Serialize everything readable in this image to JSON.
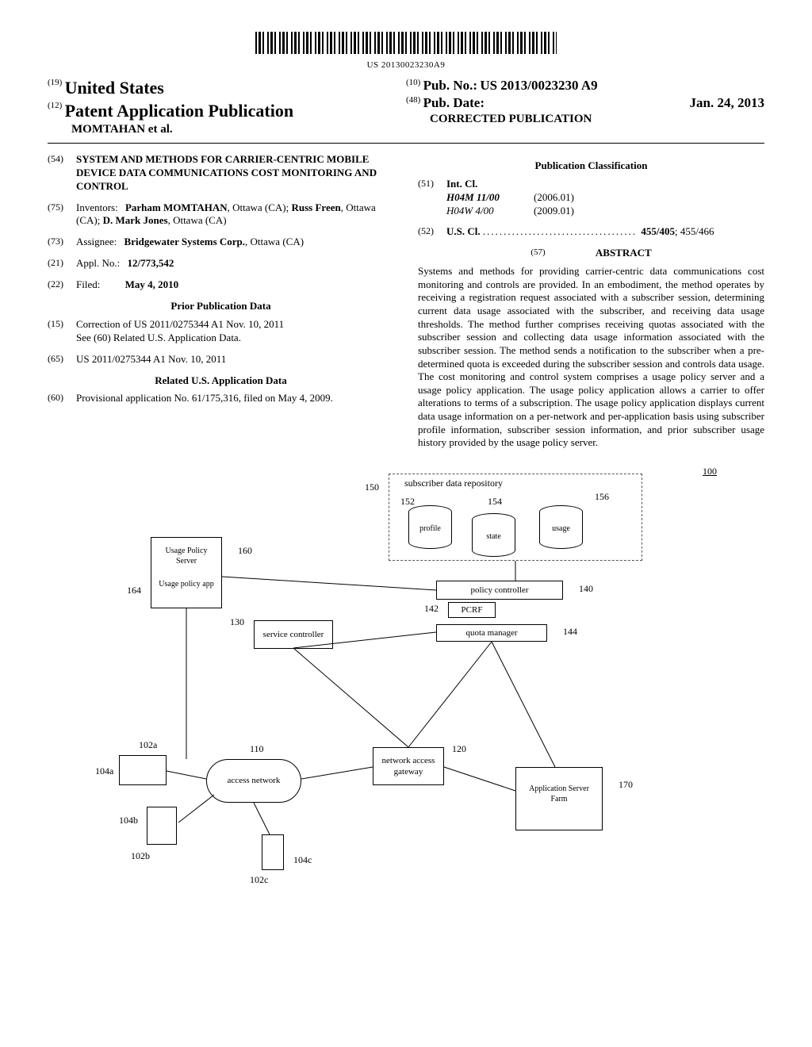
{
  "barcode_number": "US 20130023230A9",
  "header": {
    "code_19": "(19)",
    "country": "United States",
    "code_12": "(12)",
    "pub_type": "Patent Application Publication",
    "inventor_line": "MOMTAHAN et al.",
    "code_10": "(10)",
    "pub_no_label": "Pub. No.:",
    "pub_no": "US 2013/0023230 A9",
    "code_48": "(48)",
    "pub_date_label": "Pub. Date:",
    "pub_date": "Jan. 24, 2013",
    "correction": "CORRECTED PUBLICATION"
  },
  "left": {
    "s54": {
      "code": "(54)",
      "text": "SYSTEM AND METHODS FOR CARRIER-CENTRIC MOBILE DEVICE DATA COMMUNICATIONS COST MONITORING AND CONTROL"
    },
    "s75": {
      "code": "(75)",
      "label": "Inventors:",
      "text": "Parham MOMTAHAN, Ottawa (CA); Russ Freen, Ottawa (CA); D. Mark Jones, Ottawa (CA)"
    },
    "s73": {
      "code": "(73)",
      "label": "Assignee:",
      "text": "Bridgewater Systems Corp., Ottawa (CA)"
    },
    "s21": {
      "code": "(21)",
      "label": "Appl. No.:",
      "text": "12/773,542"
    },
    "s22": {
      "code": "(22)",
      "label": "Filed:",
      "text": "May 4, 2010"
    },
    "prior_pub_head": "Prior Publication Data",
    "s15": {
      "code": "(15)",
      "text1": "Correction of US 2011/0275344 A1 Nov. 10, 2011",
      "text2": "See (60) Related U.S. Application Data."
    },
    "s65": {
      "code": "(65)",
      "text": "US 2011/0275344 A1      Nov. 10, 2011"
    },
    "related_head": "Related U.S. Application Data",
    "s60": {
      "code": "(60)",
      "text": "Provisional application No. 61/175,316, filed on May 4, 2009."
    }
  },
  "right": {
    "pub_class_head": "Publication Classification",
    "s51": {
      "code": "(51)",
      "label": "Int. Cl.",
      "r1a": "H04M 11/00",
      "r1b": "(2006.01)",
      "r2a": "H04W 4/00",
      "r2b": "(2009.01)"
    },
    "s52": {
      "code": "(52)",
      "label": "U.S. Cl.",
      "text": "455/405; 455/466"
    },
    "s57": {
      "code": "(57)",
      "head": "ABSTRACT"
    },
    "abstract": "Systems and methods for providing carrier-centric data communications cost monitoring and controls are provided. In an embodiment, the method operates by receiving a registration request associated with a subscriber session, determining current data usage associated with the subscriber, and receiving data usage thresholds. The method further comprises receiving quotas associated with the subscriber session and collecting data usage information associated with the subscriber session. The method sends a notification to the subscriber when a pre-determined quota is exceeded during the subscriber session and controls data usage. The cost monitoring and control system comprises a usage policy server and a usage policy application. The usage policy application allows a carrier to offer alterations to terms of a subscription. The usage policy application displays current data usage information on a per-network and per-application basis using subscriber profile information, subscriber session information, and prior subscriber usage history provided by the usage policy server."
  },
  "figure": {
    "ref_100": "100",
    "subscriber_repo": "subscriber data repository",
    "ref_150": "150",
    "profile": "profile",
    "ref_152": "152",
    "state": "state",
    "ref_154": "154",
    "usage": "usage",
    "ref_156": "156",
    "policy_controller": "policy controller",
    "ref_140": "140",
    "pcrf": "PCRF",
    "ref_142": "142",
    "quota_manager": "quota manager",
    "ref_144": "144",
    "usage_policy_server": "Usage Policy Server",
    "ref_160": "160",
    "usage_policy_app": "Usage policy app",
    "ref_164": "164",
    "service_controller": "service controller",
    "ref_130": "130",
    "access_network": "access network",
    "ref_110": "110",
    "network_access_gateway": "network access gateway",
    "ref_120": "120",
    "app_server_farm": "Application Server Farm",
    "ref_170": "170",
    "ref_102a": "102a",
    "ref_104a": "104a",
    "ref_102b": "102b",
    "ref_104b": "104b",
    "ref_102c": "102c",
    "ref_104c": "104c"
  }
}
